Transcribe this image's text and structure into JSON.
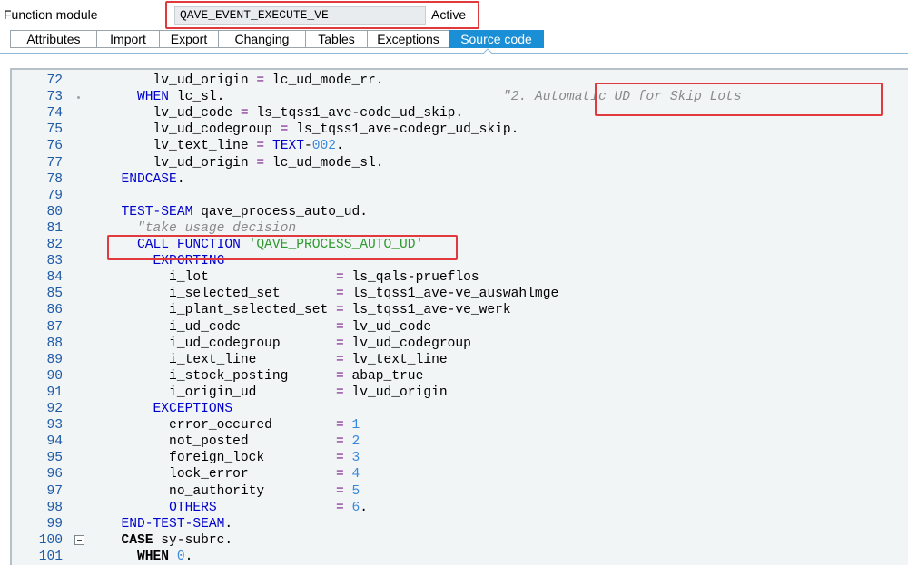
{
  "header": {
    "label": "Function module",
    "name_value": "QAVE_EVENT_EXECUTE_VE",
    "status": "Active"
  },
  "tabs": [
    {
      "label": "Attributes",
      "active": false
    },
    {
      "label": "Import",
      "active": false
    },
    {
      "label": "Export",
      "active": false
    },
    {
      "label": "Changing",
      "active": false
    },
    {
      "label": "Tables",
      "active": false
    },
    {
      "label": "Exceptions",
      "active": false
    },
    {
      "label": "Source code",
      "active": true
    }
  ],
  "colors": {
    "accent": "#1a8fd6",
    "highlight_box": "#e0393e",
    "keyword": "#0000cc",
    "string": "#2e9a2e",
    "number": "#3b87d9",
    "comment": "#8a8a8a",
    "line_number": "#1f5aa6"
  },
  "code": {
    "lines": [
      {
        "n": "72",
        "marker": "",
        "segs": [
          [
            "t",
            "      lv_ud_origin "
          ],
          [
            "eq",
            "="
          ],
          [
            "t",
            " lc_ud_mode_rr."
          ]
        ]
      },
      {
        "n": "73",
        "marker": "dot",
        "segs": [
          [
            "t",
            "    "
          ],
          [
            "kw",
            "WHEN"
          ],
          [
            "t",
            " lc_sl."
          ],
          [
            "t",
            "                                   "
          ],
          [
            "cmt",
            "\"2. Automatic UD for Skip Lots"
          ]
        ]
      },
      {
        "n": "74",
        "marker": "",
        "segs": [
          [
            "t",
            "      lv_ud_code "
          ],
          [
            "eq",
            "="
          ],
          [
            "t",
            " ls_tqss1_ave-code_ud_skip."
          ]
        ]
      },
      {
        "n": "75",
        "marker": "",
        "segs": [
          [
            "t",
            "      lv_ud_codegroup "
          ],
          [
            "eq",
            "="
          ],
          [
            "t",
            " ls_tqss1_ave-codegr_ud_skip."
          ]
        ]
      },
      {
        "n": "76",
        "marker": "",
        "segs": [
          [
            "t",
            "      lv_text_line "
          ],
          [
            "eq",
            "="
          ],
          [
            "t",
            " "
          ],
          [
            "kw",
            "TEXT"
          ],
          [
            "t",
            "-"
          ],
          [
            "num",
            "002"
          ],
          [
            "t",
            "."
          ]
        ]
      },
      {
        "n": "77",
        "marker": "",
        "segs": [
          [
            "t",
            "      lv_ud_origin "
          ],
          [
            "eq",
            "="
          ],
          [
            "t",
            " lc_ud_mode_sl."
          ]
        ]
      },
      {
        "n": "78",
        "marker": "",
        "segs": [
          [
            "t",
            "  "
          ],
          [
            "kw",
            "ENDCASE"
          ],
          [
            "t",
            "."
          ]
        ]
      },
      {
        "n": "79",
        "marker": "",
        "segs": []
      },
      {
        "n": "80",
        "marker": "",
        "segs": [
          [
            "t",
            "  "
          ],
          [
            "kw",
            "TEST-SEAM"
          ],
          [
            "t",
            " qave_process_auto_ud."
          ]
        ]
      },
      {
        "n": "81",
        "marker": "",
        "segs": [
          [
            "t",
            "    "
          ],
          [
            "cmt",
            "\"take usage decision"
          ]
        ]
      },
      {
        "n": "82",
        "marker": "",
        "segs": [
          [
            "t",
            "    "
          ],
          [
            "kw",
            "CALL FUNCTION"
          ],
          [
            "t",
            " "
          ],
          [
            "str",
            "'QAVE_PROCESS_AUTO_UD'"
          ]
        ]
      },
      {
        "n": "83",
        "marker": "",
        "segs": [
          [
            "t",
            "      "
          ],
          [
            "kw",
            "EXPORTING"
          ]
        ]
      },
      {
        "n": "84",
        "marker": "",
        "segs": [
          [
            "t",
            "        i_lot                "
          ],
          [
            "eq",
            "="
          ],
          [
            "t",
            " ls_qals-prueflos"
          ]
        ]
      },
      {
        "n": "85",
        "marker": "",
        "segs": [
          [
            "t",
            "        i_selected_set       "
          ],
          [
            "eq",
            "="
          ],
          [
            "t",
            " ls_tqss1_ave-ve_auswahlmge"
          ]
        ]
      },
      {
        "n": "86",
        "marker": "",
        "segs": [
          [
            "t",
            "        i_plant_selected_set "
          ],
          [
            "eq",
            "="
          ],
          [
            "t",
            " ls_tqss1_ave-ve_werk"
          ]
        ]
      },
      {
        "n": "87",
        "marker": "",
        "segs": [
          [
            "t",
            "        i_ud_code            "
          ],
          [
            "eq",
            "="
          ],
          [
            "t",
            " lv_ud_code"
          ]
        ]
      },
      {
        "n": "88",
        "marker": "",
        "segs": [
          [
            "t",
            "        i_ud_codegroup       "
          ],
          [
            "eq",
            "="
          ],
          [
            "t",
            " lv_ud_codegroup"
          ]
        ]
      },
      {
        "n": "89",
        "marker": "",
        "segs": [
          [
            "t",
            "        i_text_line          "
          ],
          [
            "eq",
            "="
          ],
          [
            "t",
            " lv_text_line"
          ]
        ]
      },
      {
        "n": "90",
        "marker": "",
        "segs": [
          [
            "t",
            "        i_stock_posting      "
          ],
          [
            "eq",
            "="
          ],
          [
            "t",
            " abap_true"
          ]
        ]
      },
      {
        "n": "91",
        "marker": "",
        "segs": [
          [
            "t",
            "        i_origin_ud          "
          ],
          [
            "eq",
            "="
          ],
          [
            "t",
            " lv_ud_origin"
          ]
        ]
      },
      {
        "n": "92",
        "marker": "",
        "segs": [
          [
            "t",
            "      "
          ],
          [
            "kw",
            "EXCEPTIONS"
          ]
        ]
      },
      {
        "n": "93",
        "marker": "",
        "segs": [
          [
            "t",
            "        error_occured        "
          ],
          [
            "eq",
            "="
          ],
          [
            "t",
            " "
          ],
          [
            "num",
            "1"
          ]
        ]
      },
      {
        "n": "94",
        "marker": "",
        "segs": [
          [
            "t",
            "        not_posted           "
          ],
          [
            "eq",
            "="
          ],
          [
            "t",
            " "
          ],
          [
            "num",
            "2"
          ]
        ]
      },
      {
        "n": "95",
        "marker": "",
        "segs": [
          [
            "t",
            "        foreign_lock         "
          ],
          [
            "eq",
            "="
          ],
          [
            "t",
            " "
          ],
          [
            "num",
            "3"
          ]
        ]
      },
      {
        "n": "96",
        "marker": "",
        "segs": [
          [
            "t",
            "        lock_error           "
          ],
          [
            "eq",
            "="
          ],
          [
            "t",
            " "
          ],
          [
            "num",
            "4"
          ]
        ]
      },
      {
        "n": "97",
        "marker": "",
        "segs": [
          [
            "t",
            "        no_authority         "
          ],
          [
            "eq",
            "="
          ],
          [
            "t",
            " "
          ],
          [
            "num",
            "5"
          ]
        ]
      },
      {
        "n": "98",
        "marker": "",
        "segs": [
          [
            "t",
            "        "
          ],
          [
            "kw",
            "OTHERS"
          ],
          [
            "t",
            "               "
          ],
          [
            "eq",
            "="
          ],
          [
            "t",
            " "
          ],
          [
            "num",
            "6"
          ],
          [
            "t",
            "."
          ]
        ]
      },
      {
        "n": "99",
        "marker": "",
        "segs": [
          [
            "t",
            "  "
          ],
          [
            "kw",
            "END-TEST-SEAM"
          ],
          [
            "t",
            "."
          ]
        ]
      },
      {
        "n": "100",
        "marker": "box",
        "segs": [
          [
            "t",
            "  "
          ],
          [
            "kwb",
            "CASE"
          ],
          [
            "t",
            " sy-subrc."
          ]
        ]
      },
      {
        "n": "101",
        "marker": "",
        "segs": [
          [
            "t",
            "    "
          ],
          [
            "kwb",
            "WHEN"
          ],
          [
            "t",
            " "
          ],
          [
            "num",
            "0"
          ],
          [
            "t",
            "."
          ]
        ]
      }
    ]
  }
}
